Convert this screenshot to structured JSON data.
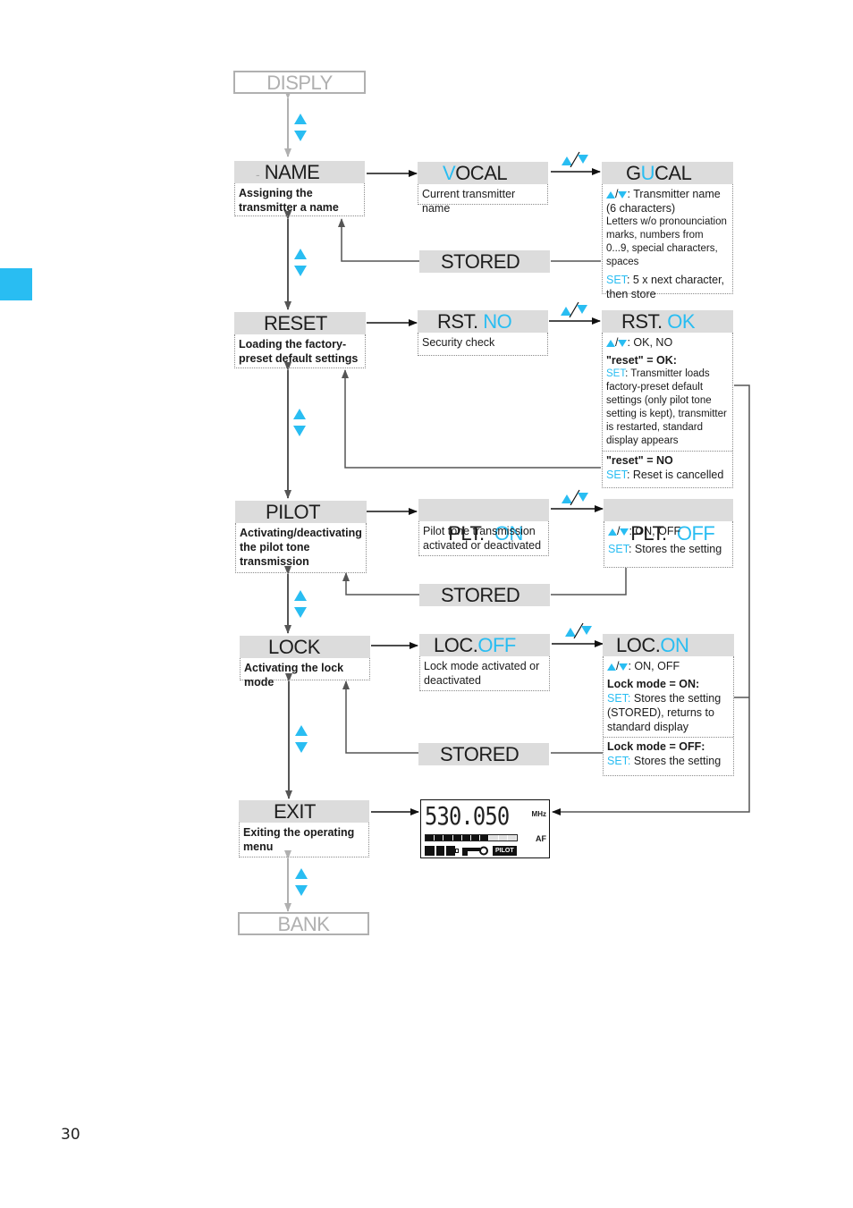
{
  "page": {
    "number": "30",
    "accent_color": "#29bdf2",
    "header_gray": "#dcdcdc"
  },
  "nav_prev": {
    "label": "DISPLY"
  },
  "nav_next": {
    "label": "BANK"
  },
  "menu": [
    {
      "id": "name",
      "title": "NAME",
      "prefix": "-",
      "description": "Assigning the transmitter a name",
      "step1": {
        "title_accent": "V",
        "title_rest": "OCAL",
        "text": "Current transmitter name"
      },
      "step2": {
        "title_pre": "G",
        "title_accent": "U",
        "title_rest": "CAL",
        "updown_text": ": Transmitter name (6 characters)",
        "note": "Letters w/o pronounciation marks, numbers from 0...9, special characters, spaces",
        "set_label": "SET",
        "set_text": ": 5 x next character, then store"
      },
      "stored": "STORED"
    },
    {
      "id": "reset",
      "title": "RESET",
      "description": "Loading the factory-preset default settings",
      "step1": {
        "title_rest": "RST. ",
        "title_accent": "NO",
        "text": "Security check"
      },
      "step2": {
        "title_rest": "RST. ",
        "title_accent": "OK",
        "updown_text": ": OK, NO",
        "ok_heading": "\"reset\" = OK:",
        "set_label": "SET",
        "ok_text": ": Transmitter loads factory-preset default settings (only pilot tone setting is kept), transmitter is restarted, standard display appears",
        "no_heading": "\"reset\" = NO",
        "no_text": ":  Reset is cancelled"
      }
    },
    {
      "id": "pilot",
      "title": "PILOT",
      "description": "Activating/deactivating the pilot tone transmission",
      "step1": {
        "title_rest": "PLT.  ",
        "title_accent": "ON",
        "text": "Pilot tone transmission activated or deactivated"
      },
      "step2": {
        "title_rest": "PLT.  ",
        "title_accent": "OFF",
        "updown_text": ": ON, OFF",
        "set_label": "SET",
        "set_text": ": Stores the setting"
      },
      "stored": "STORED"
    },
    {
      "id": "lock",
      "title": "LOCK",
      "description": "Activating the lock mode",
      "step1": {
        "title_rest": "LOC.",
        "title_accent": "OFF",
        "text": "Lock mode activated or deactivated"
      },
      "step2": {
        "title_rest": "LOC.",
        "title_accent": "ON",
        "updown_text": ": ON, OFF",
        "on_heading": "Lock mode = ON:",
        "set_label": "SET:",
        "on_text": " Stores the setting (STORED), returns to standard display",
        "off_heading": "Lock mode = OFF:",
        "off_text": " Stores the setting"
      },
      "stored": "STORED"
    },
    {
      "id": "exit",
      "title": "EXIT",
      "description": "Exiting the operating menu"
    }
  ],
  "toggle_icon": {
    "name": "up-down-toggle",
    "separator": "/"
  },
  "lcd": {
    "frequency": "530.050",
    "unit": "MHz",
    "af_label": "AF",
    "af_level": 0.7,
    "af_segments": 10,
    "pilot_label": "PILOT",
    "battery_bars": 3
  }
}
